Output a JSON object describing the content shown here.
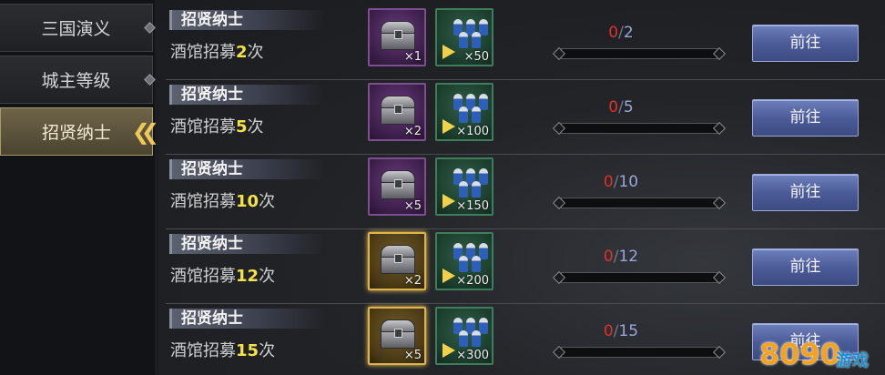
{
  "sidebar": {
    "tabs": [
      {
        "label": "三国演义",
        "active": false
      },
      {
        "label": "城主等级",
        "active": false
      },
      {
        "label": "招贤纳士",
        "active": true
      }
    ]
  },
  "tasks": [
    {
      "title": "招贤纳士",
      "desc_prefix": "酒馆招募",
      "count": "2",
      "desc_suffix": "次",
      "reward1": {
        "type": "purple-chest",
        "qty": "×1"
      },
      "reward2": {
        "type": "soldiers",
        "qty": "×50"
      },
      "progress_current": "0",
      "progress_sep": "/",
      "progress_total": "2",
      "button": "前往"
    },
    {
      "title": "招贤纳士",
      "desc_prefix": "酒馆招募",
      "count": "5",
      "desc_suffix": "次",
      "reward1": {
        "type": "purple-chest",
        "qty": "×2"
      },
      "reward2": {
        "type": "soldiers",
        "qty": "×100"
      },
      "progress_current": "0",
      "progress_sep": "/",
      "progress_total": "5",
      "button": "前往"
    },
    {
      "title": "招贤纳士",
      "desc_prefix": "酒馆招募",
      "count": "10",
      "desc_suffix": "次",
      "reward1": {
        "type": "purple-chest",
        "qty": "×5"
      },
      "reward2": {
        "type": "soldiers",
        "qty": "×150"
      },
      "progress_current": "0",
      "progress_sep": "/",
      "progress_total": "10",
      "button": "前往"
    },
    {
      "title": "招贤纳士",
      "desc_prefix": "酒馆招募",
      "count": "12",
      "desc_suffix": "次",
      "reward1": {
        "type": "gold-chest",
        "qty": "×2"
      },
      "reward2": {
        "type": "soldiers",
        "qty": "×200"
      },
      "progress_current": "0",
      "progress_sep": "/",
      "progress_total": "12",
      "button": "前往"
    },
    {
      "title": "招贤纳士",
      "desc_prefix": "酒馆招募",
      "count": "15",
      "desc_suffix": "次",
      "reward1": {
        "type": "gold-chest",
        "qty": "×5"
      },
      "reward2": {
        "type": "soldiers",
        "qty": "×300"
      },
      "progress_current": "0",
      "progress_sep": "/",
      "progress_total": "15",
      "button": "前往"
    }
  ],
  "watermark": {
    "number": "8090",
    "text": "游戏"
  },
  "colors": {
    "accent_gold": "#f0c85a",
    "progress_current": "#e0302a",
    "button_blue": "#4c5c98",
    "count_yellow": "#f3e24a"
  }
}
